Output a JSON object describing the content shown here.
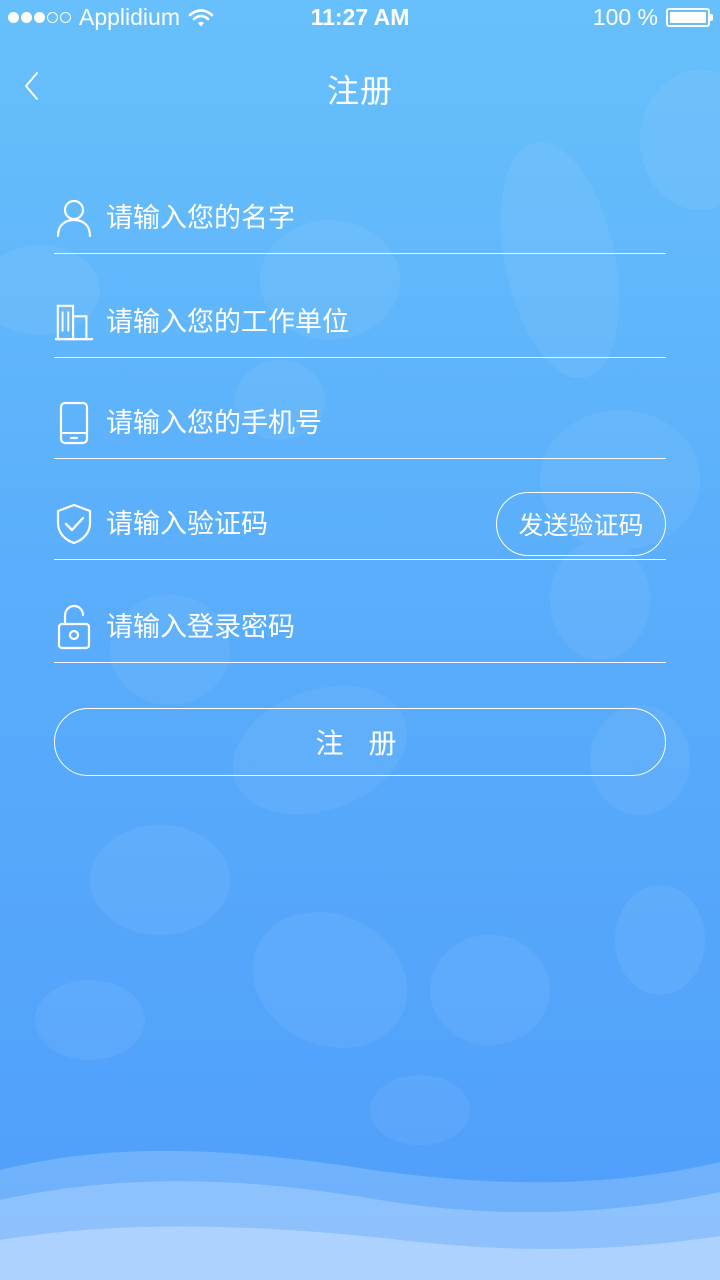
{
  "status_bar": {
    "carrier": "Applidium",
    "time": "11:27 AM",
    "battery": "100 %",
    "signal_filled": 3,
    "signal_total": 5
  },
  "nav": {
    "title": "注册",
    "back_icon": "chevron-left-icon"
  },
  "form": {
    "name_placeholder": "请输入您的名字",
    "company_placeholder": "请输入您的工作单位",
    "phone_placeholder": "请输入您的手机号",
    "code_placeholder": "请输入验证码",
    "send_code_label": "发送验证码",
    "password_placeholder": "请输入登录密码",
    "icons": [
      "user-icon",
      "building-icon",
      "phone-icon",
      "shield-check-icon",
      "lock-icon"
    ]
  },
  "register_button": {
    "label": "注 册"
  },
  "colors": {
    "background_top": "#67c0fb",
    "background_bottom": "#4f9efb",
    "foreground": "#ffffff"
  }
}
